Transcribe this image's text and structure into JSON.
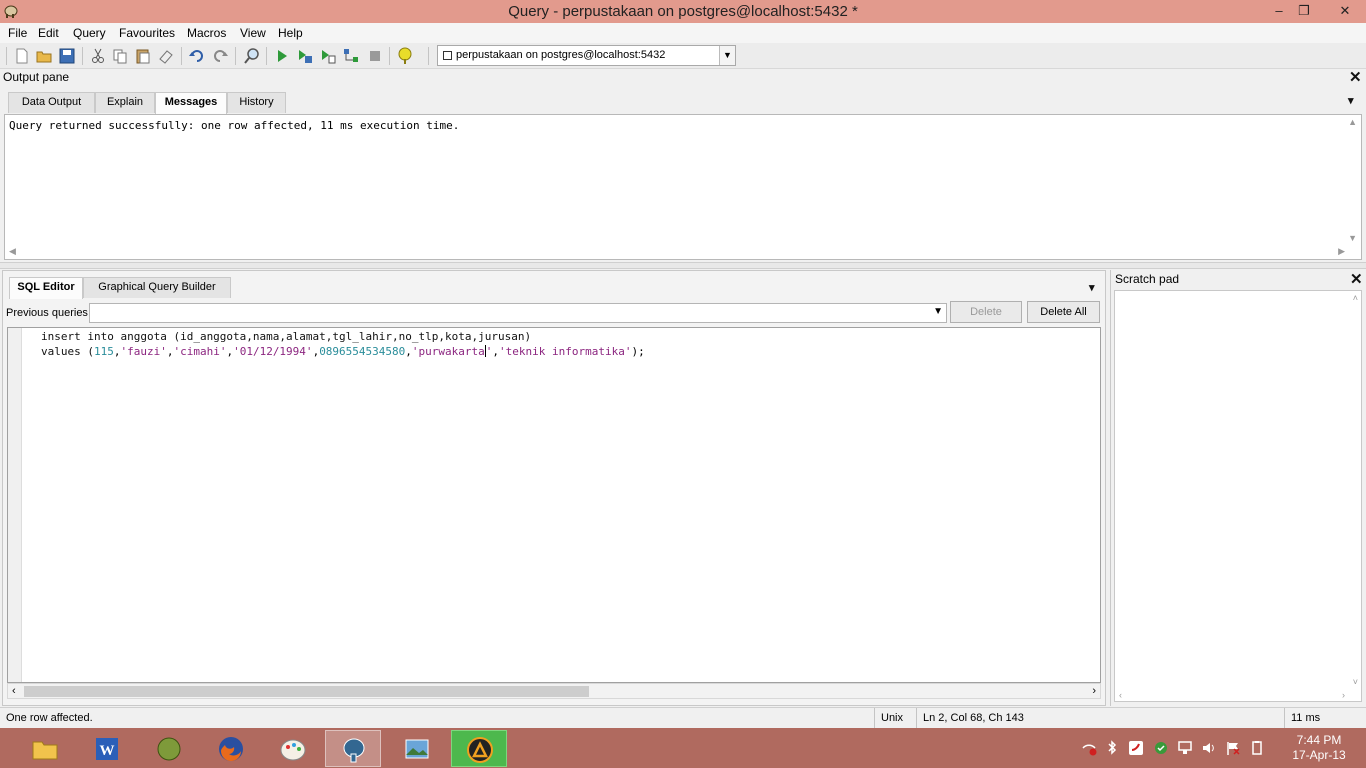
{
  "window": {
    "title": "Query - perpustakaan on postgres@localhost:5432 *",
    "minimize_glyph": "–",
    "restore_glyph": "❐",
    "close_glyph": "✕"
  },
  "menu": [
    "File",
    "Edit",
    "Query",
    "Favourites",
    "Macros",
    "View",
    "Help"
  ],
  "toolbar": {
    "buttons": [
      "new-icon",
      "open-icon",
      "save-icon",
      "cut-icon",
      "copy-icon",
      "paste-icon",
      "clear-icon",
      "undo-icon",
      "redo-icon",
      "find-icon",
      "execute-icon",
      "execute-pgscript-icon",
      "execute-to-file-icon",
      "explain-icon",
      "cancel-query-icon",
      "help-icon"
    ],
    "connection": "perpustakaan on postgres@localhost:5432",
    "dropdown_glyph": "▼"
  },
  "output_pane": {
    "title": "Output pane",
    "close_glyph": "✕",
    "menu_glyph": "▾",
    "tabs": [
      "Data Output",
      "Explain",
      "Messages",
      "History"
    ],
    "active_tab": "Messages",
    "message": "Query returned successfully: one row affected, 11 ms execution time."
  },
  "editor": {
    "tabs": [
      "SQL Editor",
      "Graphical Query Builder"
    ],
    "active_tab": "SQL Editor",
    "menu_glyph": "▾",
    "previous_queries_label": "Previous queries",
    "previous_queries_value": "",
    "delete_label": "Delete",
    "delete_all_label": "Delete All",
    "line1": "insert into anggota (id_anggota,nama,alamat,tgl_lahir,no_tlp,kota,jurusan)",
    "line2": {
      "kw": "values (",
      "n1": "115",
      "c1": ",",
      "s1": "'fauzi'",
      "c2": ",",
      "s2": "'cimahi'",
      "c3": ",",
      "s3": "'01/12/1994'",
      "c4": ",",
      "n2": "0896554534580",
      "c5": ",",
      "s4a": "'purwakarta",
      "s4b": "'",
      "c6": ",",
      "s5": "'teknik informatika'",
      "end": ");"
    }
  },
  "scratch_pad": {
    "title": "Scratch pad",
    "close_glyph": "✕",
    "content": ""
  },
  "status_bar": {
    "message": "One row affected.",
    "line_ending": "Unix",
    "position": "Ln 2, Col 68, Ch 143",
    "time": "11 ms"
  },
  "taskbar": {
    "apps": [
      "file-explorer-icon",
      "word-icon",
      "csio-icon",
      "firefox-icon",
      "paint-icon",
      "pgadmin-icon",
      "photos-icon",
      "ares-icon"
    ],
    "tray": [
      "network-warning-icon",
      "bluetooth-icon",
      "antivirus-icon",
      "security-check-icon",
      "network-icon",
      "volume-icon",
      "flag-icon",
      "power-icon"
    ],
    "time": "7:44 PM",
    "date": "17-Apr-13"
  },
  "colors": {
    "titlebar": "#e29a8d",
    "taskbar": "#b06a5f",
    "code_number": "#2a8d9a",
    "code_string": "#8c2680"
  }
}
